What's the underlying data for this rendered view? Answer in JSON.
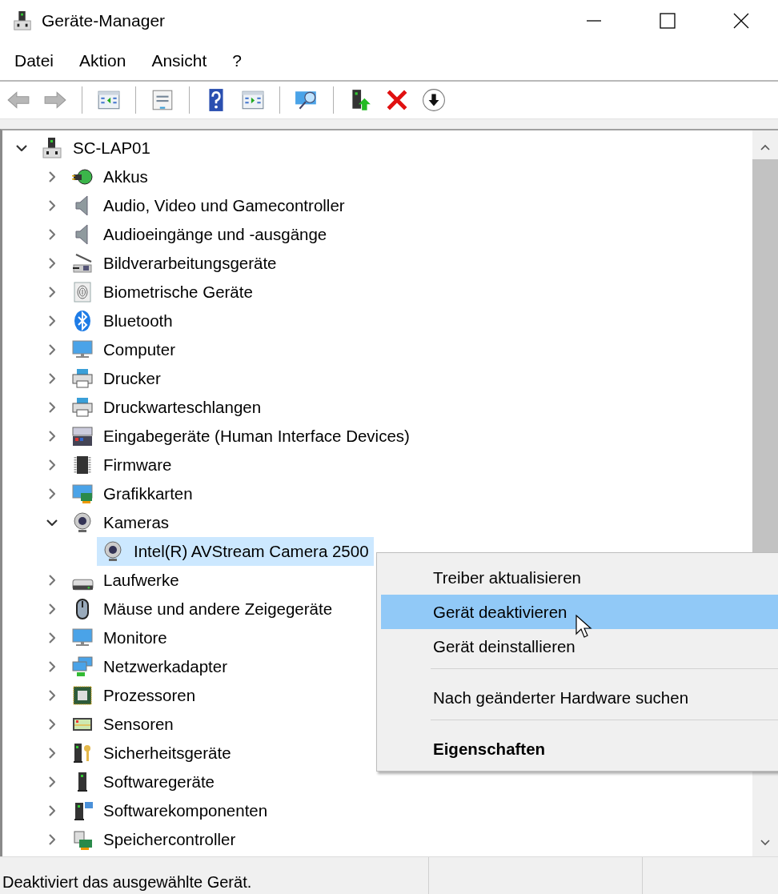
{
  "window": {
    "title": "Geräte-Manager"
  },
  "menu": [
    "Datei",
    "Aktion",
    "Ansicht",
    "?"
  ],
  "toolbar": [
    {
      "disabled": true
    },
    {
      "disabled": true
    },
    {
      "disabled": false,
      "separator_before": true
    },
    {
      "disabled": false,
      "separator_before": true
    },
    {
      "disabled": false,
      "separator_before": true
    },
    {
      "disabled": false
    },
    {
      "disabled": false,
      "separator_before": true
    },
    {
      "disabled": false,
      "separator_before": true
    },
    {
      "disabled": false
    },
    {
      "disabled": false
    }
  ],
  "tree": {
    "label": "SC-LAP01",
    "expanded": true,
    "selected": false,
    "children": [
      {
        "label": "Akkus",
        "expanded": false,
        "selected": false
      },
      {
        "label": "Audio, Video und Gamecontroller",
        "expanded": false,
        "selected": false
      },
      {
        "label": "Audioeingänge und -ausgänge",
        "expanded": false,
        "selected": false
      },
      {
        "label": "Bildverarbeitungsgeräte",
        "expanded": false,
        "selected": false
      },
      {
        "label": "Biometrische Geräte",
        "expanded": false,
        "selected": false
      },
      {
        "label": "Bluetooth",
        "expanded": false,
        "selected": false
      },
      {
        "label": "Computer",
        "expanded": false,
        "selected": false
      },
      {
        "label": "Drucker",
        "expanded": false,
        "selected": false
      },
      {
        "label": "Druckwarteschlangen",
        "expanded": false,
        "selected": false
      },
      {
        "label": "Eingabegeräte (Human Interface Devices)",
        "expanded": false,
        "selected": false
      },
      {
        "label": "Firmware",
        "expanded": false,
        "selected": false
      },
      {
        "label": "Grafikkarten",
        "expanded": false,
        "selected": false
      },
      {
        "label": "Kameras",
        "expanded": true,
        "selected": false,
        "children": [
          {
            "label": "Intel(R) AVStream Camera 2500",
            "selected": true
          }
        ]
      },
      {
        "label": "Laufwerke",
        "expanded": false,
        "selected": false
      },
      {
        "label": "Mäuse und andere Zeigegeräte",
        "expanded": false,
        "selected": false
      },
      {
        "label": "Monitore",
        "expanded": false,
        "selected": false
      },
      {
        "label": "Netzwerkadapter",
        "expanded": false,
        "selected": false
      },
      {
        "label": "Prozessoren",
        "expanded": false,
        "selected": false
      },
      {
        "label": "Sensoren",
        "expanded": false,
        "selected": false
      },
      {
        "label": "Sicherheitsgeräte",
        "expanded": false,
        "selected": false
      },
      {
        "label": "Softwaregeräte",
        "expanded": false,
        "selected": false
      },
      {
        "label": "Softwarekomponenten",
        "expanded": false,
        "selected": false
      },
      {
        "label": "Speichercontroller",
        "expanded": false,
        "selected": false
      }
    ]
  },
  "context_menu": {
    "items": [
      {
        "kind": "command",
        "label": "Treiber aktualisieren",
        "selected": false,
        "default": false
      },
      {
        "kind": "command",
        "label": "Gerät deaktivieren",
        "selected": true,
        "default": false
      },
      {
        "kind": "command",
        "label": "Gerät deinstallieren",
        "selected": false,
        "default": false
      },
      {
        "kind": "separator"
      },
      {
        "kind": "command",
        "label": "Nach geänderter Hardware suchen",
        "selected": false,
        "default": false
      },
      {
        "kind": "separator"
      },
      {
        "kind": "command",
        "label": "Eigenschaften",
        "selected": false,
        "default": true
      }
    ]
  },
  "status_bar": {
    "text": "Deaktiviert das ausgewählte Gerät."
  }
}
